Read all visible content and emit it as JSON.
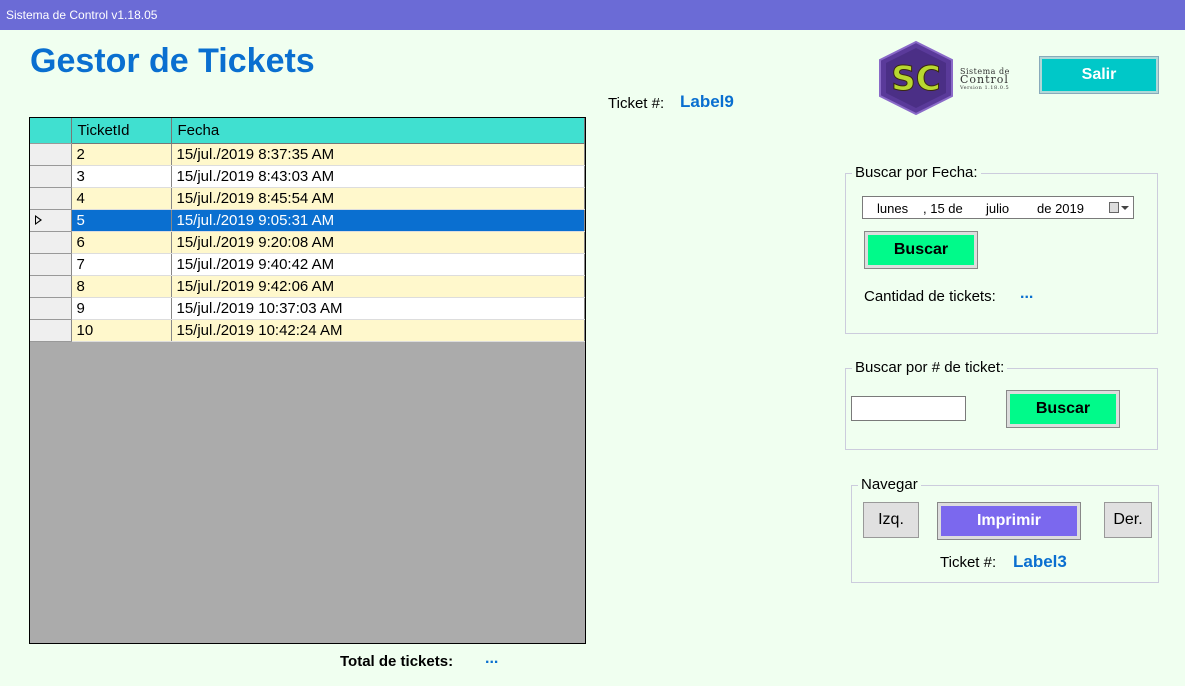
{
  "window": {
    "title": "Sistema de Control v1.18.05"
  },
  "page": {
    "title": "Gestor de Tickets"
  },
  "ticket_header": {
    "label": "Ticket #:",
    "value": "Label9"
  },
  "logo": {
    "letters": "SC",
    "line1": "Sistema de",
    "line2": "Control",
    "line3": "Version 1.18.0.5",
    "colors": {
      "hex": "#5a3a9a",
      "letters": "#b8d830"
    }
  },
  "salir_button": "Salir",
  "grid": {
    "columns": [
      "TicketId",
      "Fecha"
    ],
    "selected_index": 3,
    "rows": [
      {
        "id": "2",
        "fecha": "15/jul./2019 8:37:35 AM"
      },
      {
        "id": "3",
        "fecha": "15/jul./2019 8:43:03 AM"
      },
      {
        "id": "4",
        "fecha": "15/jul./2019 8:45:54 AM"
      },
      {
        "id": "5",
        "fecha": "15/jul./2019 9:05:31 AM"
      },
      {
        "id": "6",
        "fecha": "15/jul./2019 9:20:08 AM"
      },
      {
        "id": "7",
        "fecha": "15/jul./2019 9:40:42 AM"
      },
      {
        "id": "8",
        "fecha": "15/jul./2019 9:42:06 AM"
      },
      {
        "id": "9",
        "fecha": "15/jul./2019 10:37:03 AM"
      },
      {
        "id": "10",
        "fecha": "15/jul./2019 10:42:24 AM"
      }
    ]
  },
  "total": {
    "label": "Total de tickets:",
    "value": "..."
  },
  "buscar_fecha": {
    "title": "Buscar por Fecha:",
    "date": {
      "weekday": "lunes",
      "day": ", 15 de",
      "month": "julio",
      "year": "de 2019"
    },
    "button": "Buscar",
    "cantidad_label": "Cantidad de tickets:",
    "cantidad_value": "..."
  },
  "buscar_numero": {
    "title": "Buscar por # de ticket:",
    "input_value": "",
    "button": "Buscar"
  },
  "navegar": {
    "title": "Navegar",
    "izq": "Izq.",
    "imprimir": "Imprimir",
    "der": "Der.",
    "ticket_label": "Ticket #:",
    "ticket_value": "Label3"
  },
  "colors": {
    "accent": "#0a6fd0",
    "titlebar": "#6b6bd6",
    "grid_header": "#40e0d0",
    "search_button": "#00fa8a",
    "print_button": "#7b68ee",
    "salir_button": "#00c8c8"
  }
}
